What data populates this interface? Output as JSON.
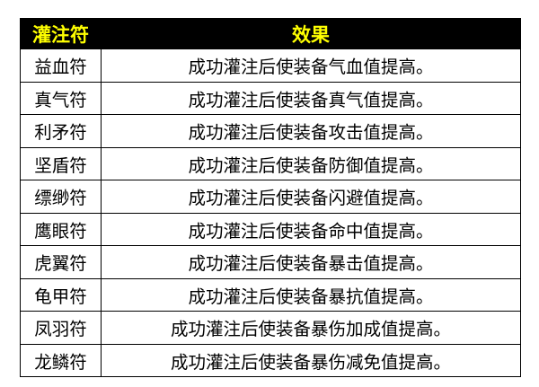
{
  "table": {
    "header": {
      "name": "灌注符",
      "effect": "效果"
    },
    "rows": [
      {
        "name": "益血符",
        "effect": "成功灌注后使装备气血值提高。"
      },
      {
        "name": "真气符",
        "effect": "成功灌注后使装备真气值提高。"
      },
      {
        "name": "利矛符",
        "effect": "成功灌注后使装备攻击值提高。"
      },
      {
        "name": "坚盾符",
        "effect": "成功灌注后使装备防御值提高。"
      },
      {
        "name": "缥缈符",
        "effect": "成功灌注后使装备闪避值提高。"
      },
      {
        "name": "鹰眼符",
        "effect": "成功灌注后使装备命中值提高。"
      },
      {
        "name": "虎翼符",
        "effect": "成功灌注后使装备暴击值提高。"
      },
      {
        "name": "龟甲符",
        "effect": "成功灌注后使装备暴抗值提高。"
      },
      {
        "name": "凤羽符",
        "effect": "成功灌注后使装备暴伤加成值提高。"
      },
      {
        "name": "龙鳞符",
        "effect": "成功灌注后使装备暴伤减免值提高。"
      }
    ]
  },
  "colors": {
    "header_background": "#000000",
    "header_text": "#ffff00",
    "body_text": "#000000",
    "border": "#000000"
  }
}
